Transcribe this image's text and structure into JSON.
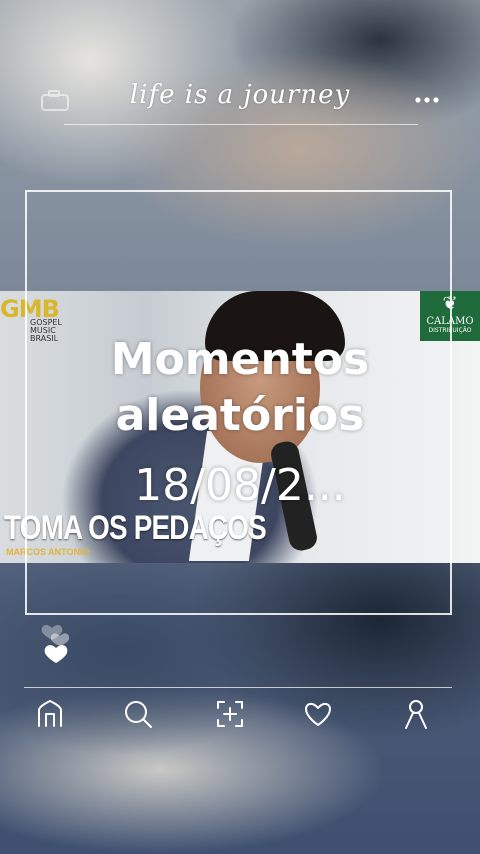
{
  "header": {
    "title": "life is a journey",
    "left_icon": "camera-icon",
    "right_icon": "more-icon"
  },
  "post": {
    "overlay_title": "Momentos aleatórios",
    "overlay_date": "18/08/2...",
    "image": {
      "song_title": "TOMA OS PEDAÇOS",
      "artist": "MARCOS ANTONIO",
      "logo_left_text": "GMB",
      "logo_left_sub": "GOSPEL MUSIC BRASIL",
      "logo_right_name": "CALAMO",
      "logo_right_tag": "DISTRIBUIÇÃO"
    }
  },
  "reactions": {
    "icon": "hearts-icon"
  },
  "bottom_nav": [
    {
      "name": "home",
      "icon": "home-icon"
    },
    {
      "name": "search",
      "icon": "search-icon"
    },
    {
      "name": "add",
      "icon": "add-icon"
    },
    {
      "name": "likes",
      "icon": "heart-icon"
    },
    {
      "name": "profile",
      "icon": "profile-icon"
    }
  ],
  "colors": {
    "accent_gold": "#e3b33a",
    "logo_green": "#1f6b3c"
  }
}
